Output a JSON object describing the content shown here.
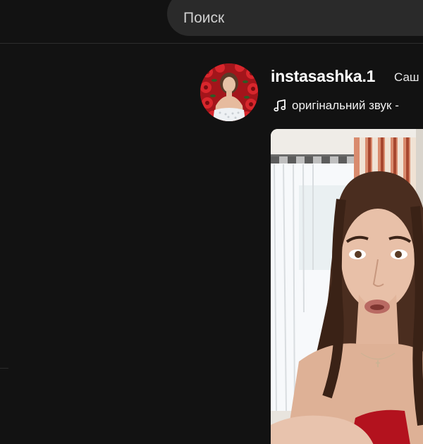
{
  "search": {
    "placeholder": "Поиск"
  },
  "post": {
    "username": "instasashka.1",
    "display_name": "Саш",
    "sound": {
      "icon": "music-note-icon",
      "text": "оригінальний звук -"
    },
    "avatar": "profile-avatar",
    "video": "video-player"
  },
  "colors": {
    "background": "#121212",
    "search_background": "#2a2a2a",
    "text_primary": "#ffffff"
  }
}
